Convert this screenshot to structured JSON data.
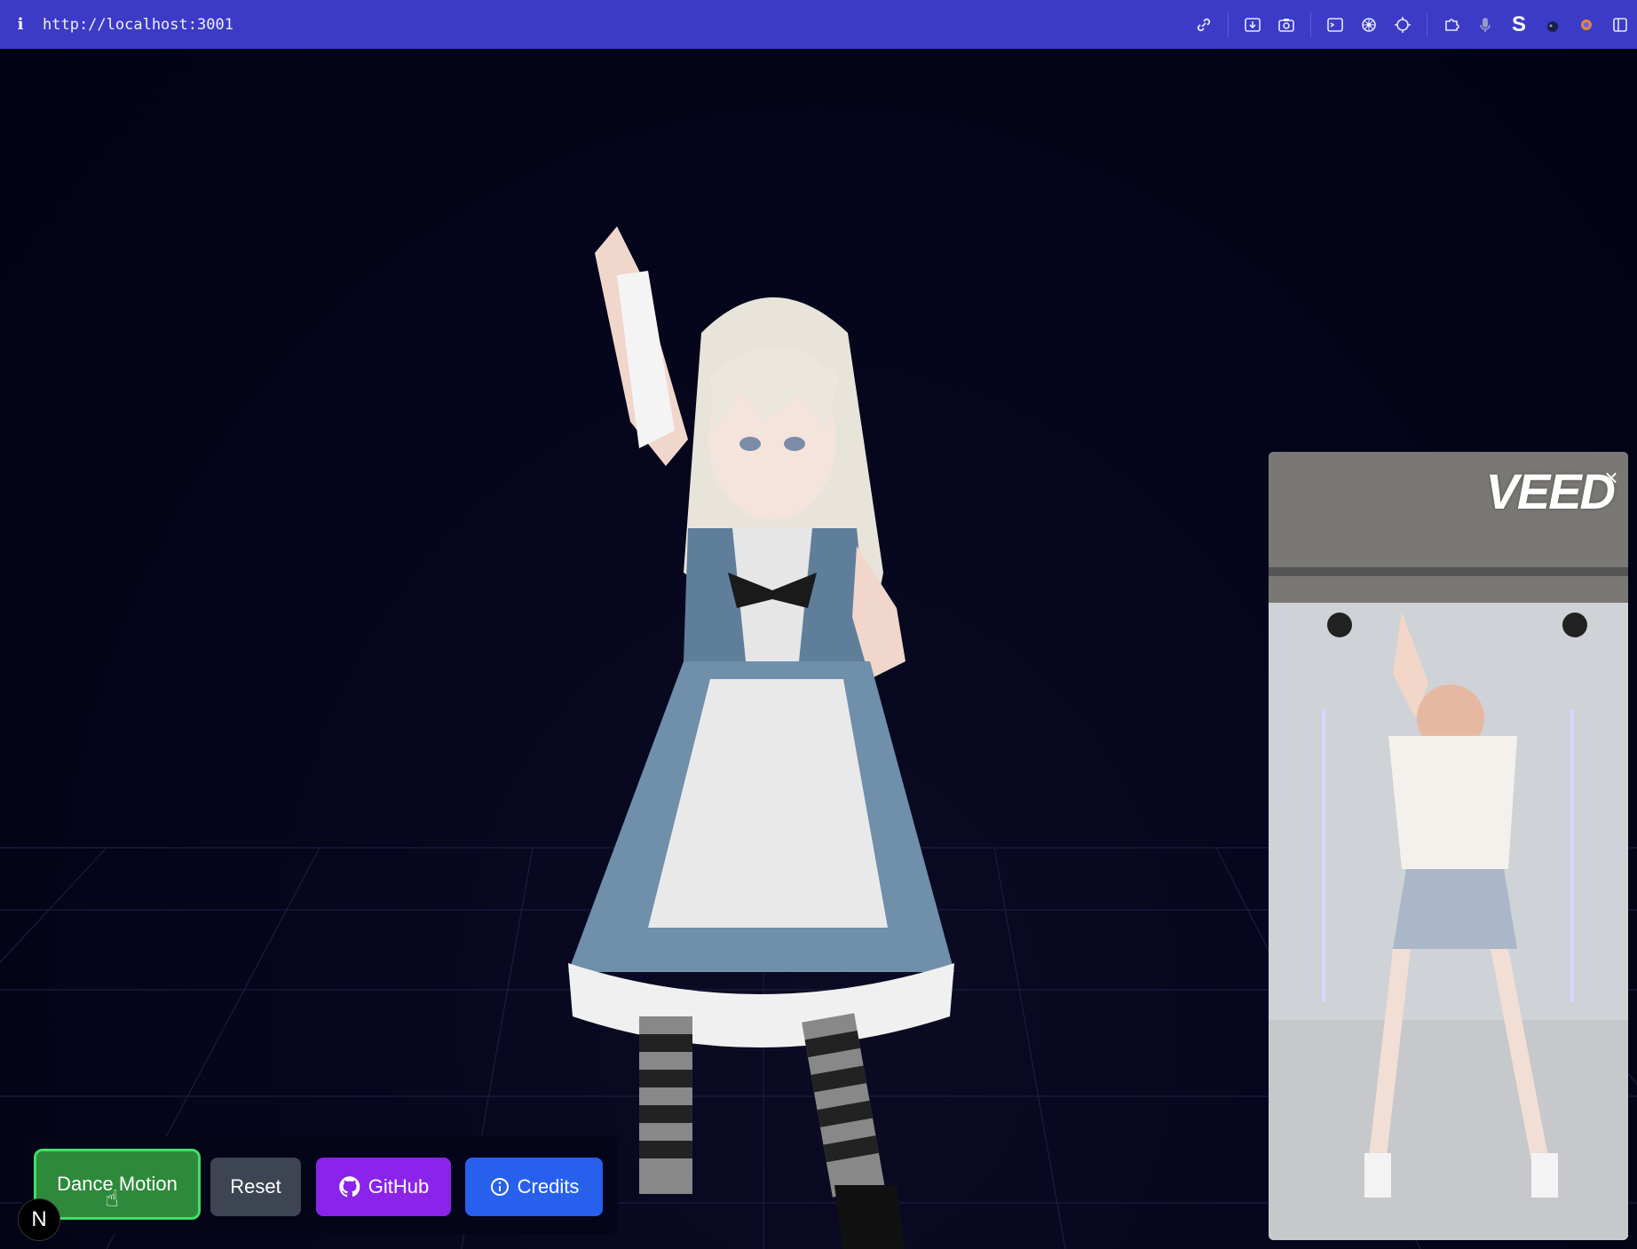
{
  "browser": {
    "url": "http://localhost:3001",
    "toolbar_icons": [
      "link-icon",
      "download-icon",
      "camera-icon",
      "terminal-icon",
      "gear-wheel-icon",
      "target-icon",
      "puzzle-icon",
      "microphone-icon",
      "s-extension-icon",
      "extension-icon",
      "sparkle-icon",
      "sidebar-icon"
    ]
  },
  "video": {
    "logo": "VEED",
    "close_symbol": "×"
  },
  "controls": {
    "dance_label": "Dance Motion",
    "reset_label": "Reset",
    "github_label": "GitHub",
    "credits_label": "Credits"
  },
  "badge": {
    "letter": "N"
  },
  "colors": {
    "topbar": "#3b3bc8",
    "scene_bg": "#03031a",
    "dance_button": "#2e8a3a",
    "dance_border": "#3fe066",
    "reset_button": "#3d4452",
    "github_button": "#8a24ea",
    "credits_button": "#2860ee"
  }
}
